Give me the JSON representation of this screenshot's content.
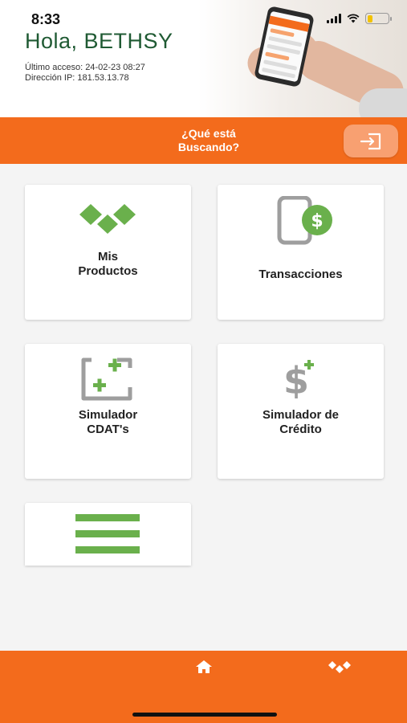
{
  "status_bar": {
    "time": "8:33",
    "battery_level": 0.25
  },
  "header": {
    "greeting": "Hola, BETHSY",
    "last_access": "Último acceso: 24-02-23 08:27",
    "ip": "Dirección IP: 181.53.13.78"
  },
  "search": {
    "label_line1": "¿Qué está",
    "label_line2": "Buscando?"
  },
  "cards": [
    {
      "label_line1": "Mis",
      "label_line2": "Productos",
      "icon": "products-diamonds-icon"
    },
    {
      "label_line1": "Transacciones",
      "label_line2": "",
      "icon": "transactions-phone-dollar-icon"
    },
    {
      "label_line1": "Simulador",
      "label_line2": "CDAT's",
      "icon": "cdat-simulator-icon"
    },
    {
      "label_line1": "Simulador de",
      "label_line2": "Crédito",
      "icon": "credit-simulator-icon"
    },
    {
      "label_line1": "",
      "label_line2": "",
      "icon": "menu-lines-icon"
    }
  ],
  "bottom_nav": {
    "items": [
      "home-icon",
      "products-icon"
    ]
  },
  "colors": {
    "accent": "#f36b1c",
    "green": "#6ab04c",
    "dark_green": "#1f5a33",
    "gray": "#9e9e9e"
  }
}
